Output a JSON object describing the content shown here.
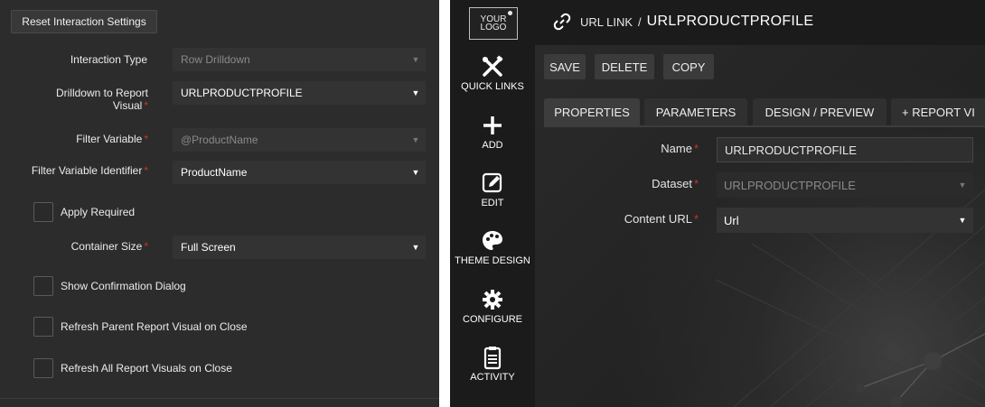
{
  "left_form": {
    "reset_button": "Reset Interaction Settings",
    "fields": [
      {
        "label": "Interaction Type",
        "required": false,
        "value": "Row Drilldown",
        "enabled": false
      },
      {
        "label_line1": "Drilldown to Report",
        "label_line2": "Visual",
        "required": true,
        "value": "URLPRODUCTPROFILE",
        "enabled": true
      },
      {
        "label": "Filter Variable",
        "required": true,
        "value": "@ProductName",
        "enabled": false
      },
      {
        "label": "Filter Variable Identifier",
        "required": true,
        "value": "ProductName",
        "enabled": true
      },
      {
        "label": "Container Size",
        "required": true,
        "value": "Full Screen",
        "enabled": true
      }
    ],
    "required_mark": "*",
    "checkboxes": [
      {
        "label": "Apply Required",
        "checked": false
      },
      {
        "label": "Show Confirmation Dialog",
        "checked": false
      },
      {
        "label": "Refresh Parent Report Visual on Close",
        "checked": false
      },
      {
        "label": "Refresh All Report Visuals on Close",
        "checked": false
      }
    ]
  },
  "app": {
    "logo": {
      "line1": "YOUR",
      "line2": "LOGO"
    },
    "sidebar": [
      {
        "label": "QUICK LINKS",
        "icon": "tools-icon"
      },
      {
        "label": "ADD",
        "icon": "plus-icon"
      },
      {
        "label": "EDIT",
        "icon": "edit-icon"
      },
      {
        "label": "THEME DESIGN",
        "icon": "palette-icon"
      },
      {
        "label": "CONFIGURE",
        "icon": "gear-icon"
      },
      {
        "label": "ACTIVITY",
        "icon": "clipboard-icon"
      }
    ],
    "header": {
      "section": "URL LINK",
      "separator": "/",
      "title": "URLPRODUCTPROFILE",
      "icon": "link-icon"
    },
    "actions": {
      "save": "SAVE",
      "delete": "DELETE",
      "copy": "COPY"
    },
    "tabs": [
      "PROPERTIES",
      "PARAMETERS",
      "DESIGN / PREVIEW",
      "+ REPORT VI"
    ],
    "active_tab": "PROPERTIES",
    "properties": {
      "name_label": "Name",
      "name_value": "URLPRODUCTPROFILE",
      "dataset_label": "Dataset",
      "dataset_value": "URLPRODUCTPROFILE",
      "content_url_label": "Content URL",
      "content_url_value": "Url"
    }
  },
  "colors": {
    "required": "#c0392b",
    "panel_bg": "#2c2c2c",
    "sidebar_bg": "#1b1b1b"
  }
}
